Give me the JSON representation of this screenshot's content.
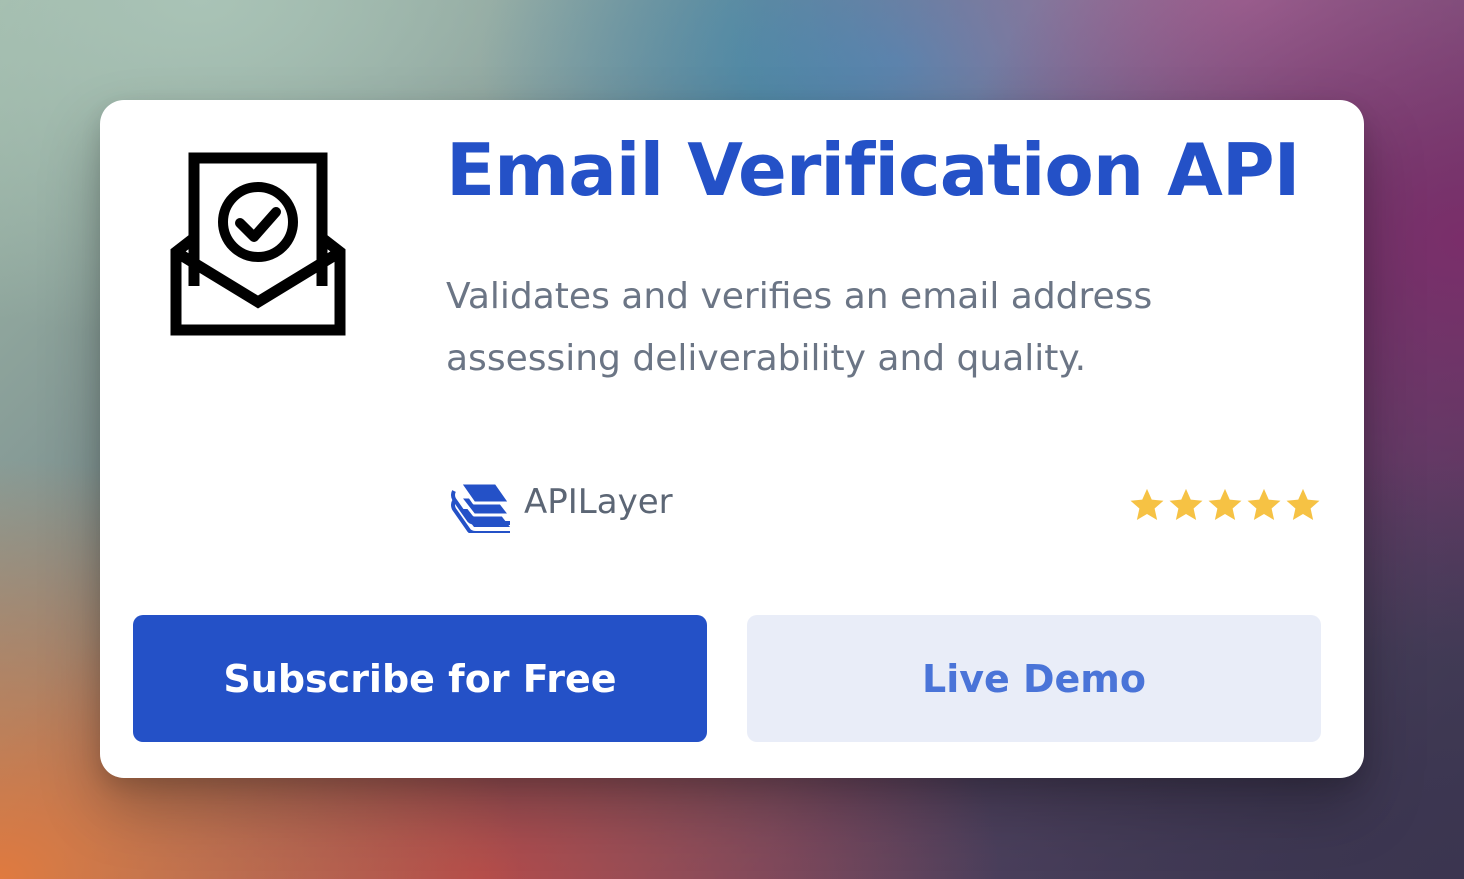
{
  "card": {
    "icon": "email-verified-envelope-icon",
    "title": "Email Verification API",
    "description": "Validates and verifies an email address assessing deliverability and quality.",
    "provider": {
      "logo": "apilayer-logo",
      "name": "APILayer"
    },
    "rating": {
      "stars": 5,
      "max": 5,
      "color": "#f6c244"
    },
    "buttons": {
      "subscribe_label": "Subscribe for Free",
      "demo_label": "Live Demo"
    }
  },
  "colors": {
    "accent": "#2451c7",
    "secondary_button_bg": "#e9edf8",
    "secondary_button_text": "#4a74d8",
    "description_text": "#6b7585"
  }
}
